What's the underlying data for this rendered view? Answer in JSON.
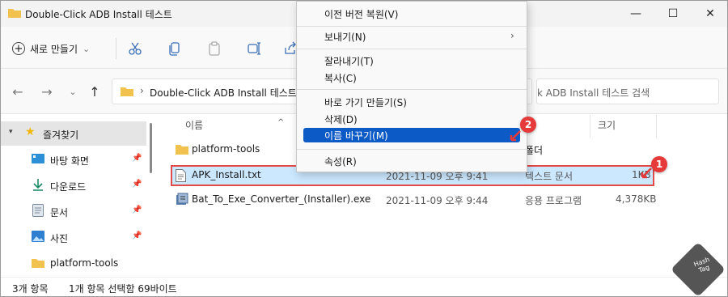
{
  "window": {
    "title": "Double-Click ADB Install 테스트",
    "minimize": "—",
    "maximize": "☐",
    "close": "✕"
  },
  "toolbar": {
    "new_label": "새로 만들기",
    "new_dropdown": "⌄"
  },
  "address": {
    "chevron": "›",
    "path": "Double-Click ADB Install 테스트",
    "search_placeholder": "k ADB Install 테스트 검색"
  },
  "nav": {
    "back": "←",
    "forward": "→",
    "up": "↑"
  },
  "sidebar": {
    "items": [
      {
        "label": "즐겨찾기",
        "icon": "star-icon"
      },
      {
        "label": "바탕 화면",
        "icon": "desktop-icon"
      },
      {
        "label": "다운로드",
        "icon": "download-icon"
      },
      {
        "label": "문서",
        "icon": "document-icon"
      },
      {
        "label": "사진",
        "icon": "pictures-icon"
      },
      {
        "label": "platform-tools",
        "icon": "folder-icon"
      }
    ]
  },
  "columns": {
    "name": "이름",
    "size": "크기"
  },
  "files": [
    {
      "name": "platform-tools",
      "date": "",
      "type": "폴더",
      "size": ""
    },
    {
      "name": "APK_Install.txt",
      "date": "2021-11-09 오후 9:41",
      "type": "텍스트 문서",
      "size": "1KB"
    },
    {
      "name": "Bat_To_Exe_Converter_(Installer).exe",
      "date": "2021-11-09 오후 9:44",
      "type": "응용 프로그램",
      "size": "4,378KB"
    }
  ],
  "status": {
    "count": "3개 항목",
    "selection": "1개 항목 선택함 69바이트"
  },
  "context_menu": {
    "items": [
      {
        "label": "이전 버전 복원(V)"
      },
      {
        "label": "보내기(N)",
        "submenu": "›"
      },
      {
        "label": "잘라내기(T)"
      },
      {
        "label": "복사(C)"
      },
      {
        "label": "바로 가기 만들기(S)"
      },
      {
        "label": "삭제(D)"
      },
      {
        "label": "이름 바꾸기(M)"
      },
      {
        "label": "속성(R)"
      }
    ]
  },
  "badges": {
    "one": "1",
    "two": "2"
  },
  "watermark": {
    "line1": "Hash",
    "line2": "Tag"
  },
  "colors": {
    "highlight": "#0c5ac5",
    "selection": "#cce8ff",
    "badge": "#e63a3a",
    "folder": "#f2c24f"
  }
}
